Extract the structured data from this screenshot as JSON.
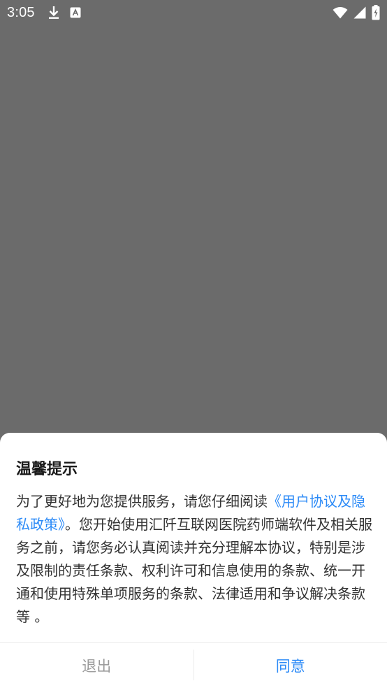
{
  "status_bar": {
    "time": "3:05",
    "icons_left": [
      "download-icon",
      "a-text-icon"
    ],
    "icons_right": [
      "wifi-icon",
      "signal-icon",
      "battery-charging-icon"
    ]
  },
  "dialog": {
    "title": "温馨提示",
    "body_before": "为了更好地为您提供服务，请您仔细阅读",
    "link_text": "《用户协议及隐私政策》",
    "body_after": "。您开始使用汇阡互联网医院药师端软件及相关服务之前，请您务必认真阅读并充分理解本协议，特别是涉及限制的责任条款、权利许可和信息使用的条款、统一开通和使用特殊单项服务的条款、法律适用和争议解决条款等 。",
    "exit_label": "退出",
    "agree_label": "同意"
  },
  "colors": {
    "overlay": "#6b6b6b",
    "link": "#2b8af7",
    "exit_text": "#9a9a9a"
  }
}
